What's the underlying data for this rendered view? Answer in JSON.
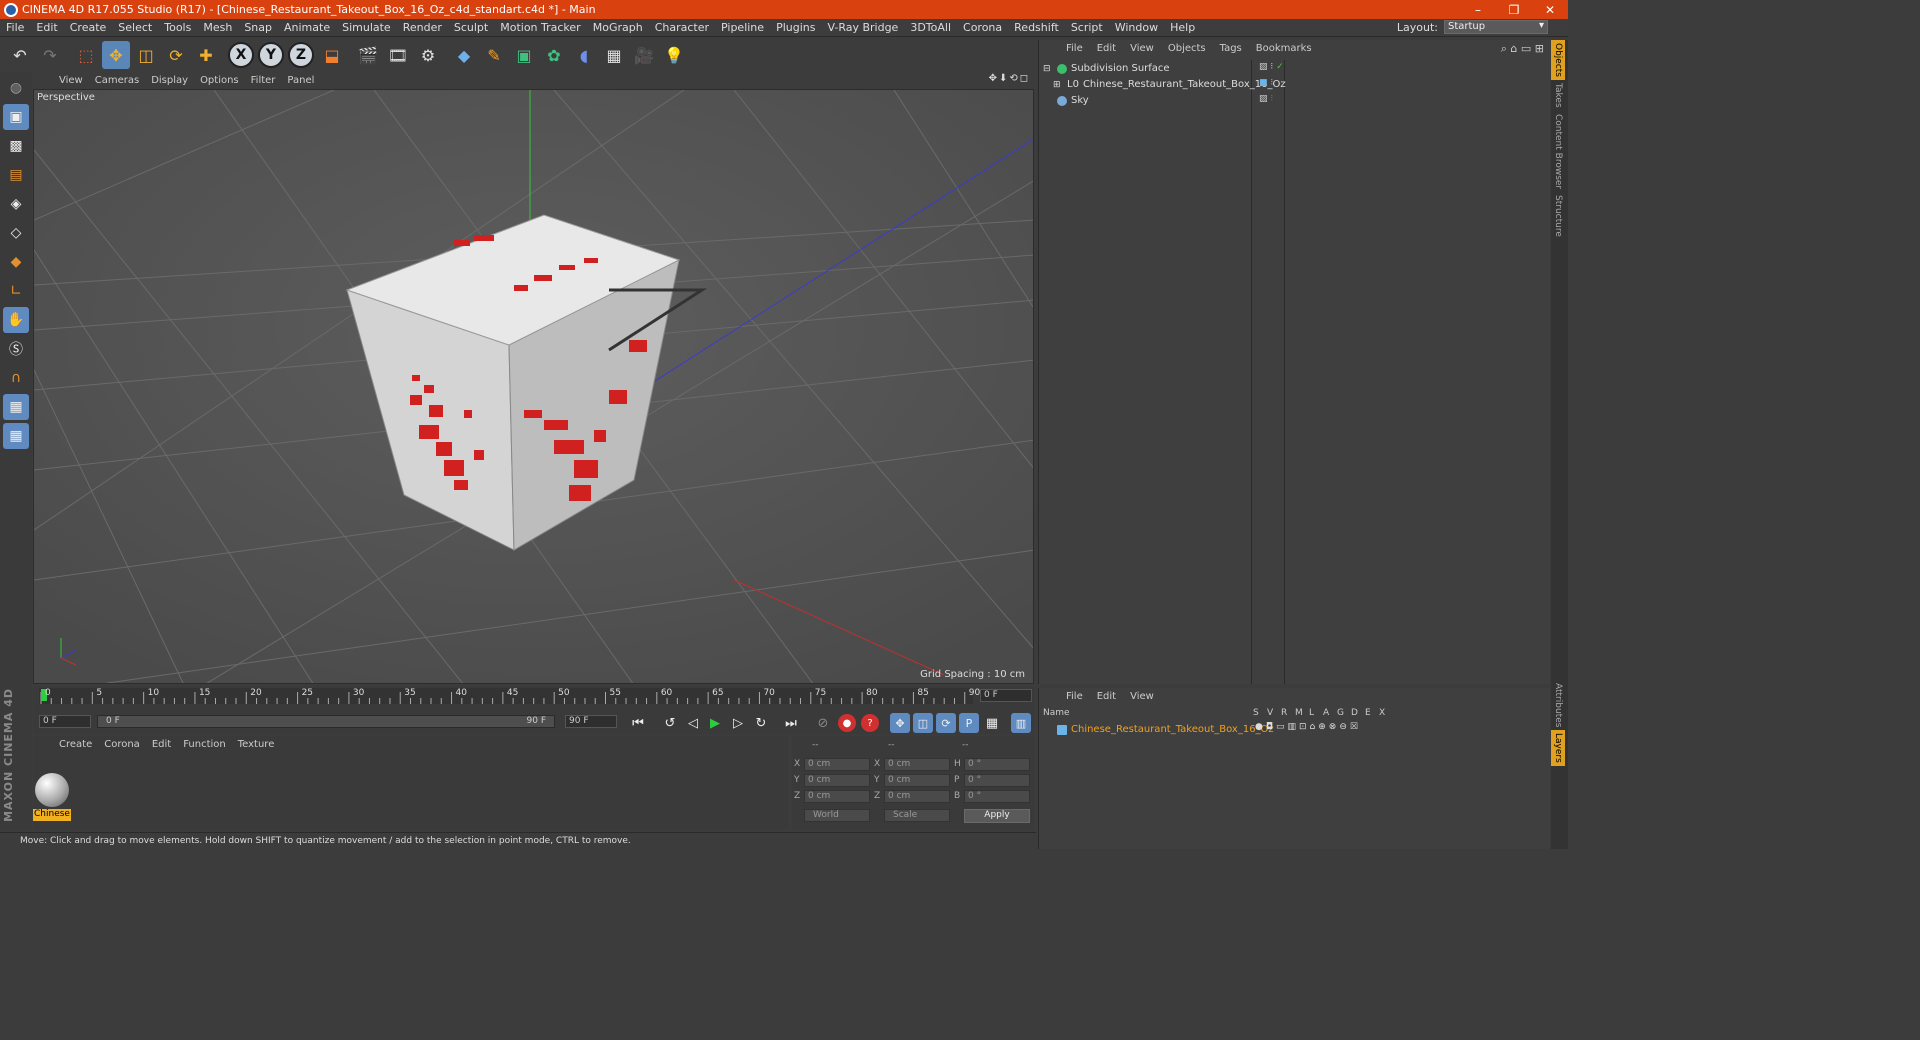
{
  "window": {
    "title": "CINEMA 4D R17.055 Studio (R17) - [Chinese_Restaurant_Takeout_Box_16_Oz_c4d_standart.c4d *] - Main",
    "controls": [
      "–",
      "❐",
      "✕"
    ]
  },
  "menubar": {
    "items": [
      "File",
      "Edit",
      "Create",
      "Select",
      "Tools",
      "Mesh",
      "Snap",
      "Animate",
      "Simulate",
      "Render",
      "Sculpt",
      "Motion Tracker",
      "MoGraph",
      "Character",
      "Pipeline",
      "Plugins",
      "V-Ray Bridge",
      "3DToAll",
      "Corona",
      "Redshift",
      "Script",
      "Window",
      "Help"
    ],
    "layout_label": "Layout:",
    "layout_value": "Startup"
  },
  "viewport": {
    "menu": [
      "View",
      "Cameras",
      "Display",
      "Options",
      "Filter",
      "Panel"
    ],
    "label": "Perspective",
    "grid_spacing": "Grid Spacing : 10 cm",
    "nav_icons": "✥⬇⟲◻"
  },
  "timeline": {
    "ticks": [
      "0",
      "5",
      "10",
      "15",
      "20",
      "25",
      "30",
      "35",
      "40",
      "45",
      "50",
      "55",
      "60",
      "65",
      "70",
      "75",
      "80",
      "85",
      "90"
    ],
    "current_frame": "0 F",
    "start_field": "0 F",
    "slider_start": "0 F",
    "slider_end": "90 F",
    "end_field": "90 F"
  },
  "material_panel": {
    "menu": [
      "Create",
      "Corona",
      "Edit",
      "Function",
      "Texture"
    ],
    "material_name": "Chinese"
  },
  "coordinates": {
    "headers": [
      "--",
      "--",
      "--"
    ],
    "rows": [
      {
        "a": "X",
        "av": "0 cm",
        "b": "X",
        "bv": "0 cm",
        "c": "H",
        "cv": "0 °"
      },
      {
        "a": "Y",
        "av": "0 cm",
        "b": "Y",
        "bv": "0 cm",
        "c": "P",
        "cv": "0 °"
      },
      {
        "a": "Z",
        "av": "0 cm",
        "b": "Z",
        "bv": "0 cm",
        "c": "B",
        "cv": "0 °"
      }
    ],
    "world": "World",
    "scale": "Scale",
    "apply": "Apply"
  },
  "status": "Move: Click and drag to move elements. Hold down SHIFT to quantize movement / add to the selection in point mode, CTRL to remove.",
  "objects_panel": {
    "menu": [
      "File",
      "Edit",
      "View",
      "Objects",
      "Tags",
      "Bookmarks"
    ],
    "objects": [
      "Subdivision Surface",
      "Chinese_Restaurant_Takeout_Box_16_Oz",
      "Sky"
    ]
  },
  "layers_panel": {
    "menu": [
      "File",
      "Edit",
      "View"
    ],
    "header_name": "Name",
    "columns": [
      "S",
      "V",
      "R",
      "M",
      "L",
      "A",
      "G",
      "D",
      "E",
      "X"
    ],
    "layer": "Chinese_Restaurant_Takeout_Box_16_Oz"
  },
  "side_tabs": [
    "Objects",
    "Takes",
    "Content Browser",
    "Structure",
    "Attributes",
    "Layers"
  ],
  "logo": "MAXON CINEMA 4D",
  "colors": {
    "titlebar": "#d9420f",
    "accent_blue": "#5f8bc0",
    "layer_text": "#f0a020"
  }
}
